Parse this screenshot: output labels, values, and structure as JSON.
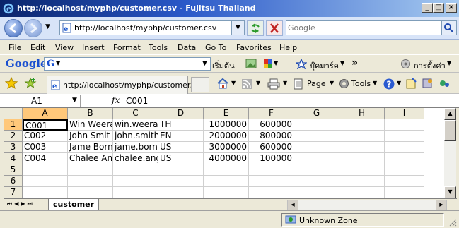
{
  "window": {
    "title": "http://localhost/myphp/customer.csv - Fujitsu Thailand"
  },
  "address": {
    "url": "http://localhost/myphp/customer.csv"
  },
  "search": {
    "placeholder": "Google"
  },
  "menu": [
    "File",
    "Edit",
    "View",
    "Insert",
    "Format",
    "Tools",
    "Data",
    "Go To",
    "Favorites",
    "Help"
  ],
  "google_bar": {
    "logo": "Google",
    "search_letter": "G",
    "search_btn": "เริ่มต้น",
    "bookmarks": "บุ๊คมาร์ค",
    "settings": "การตั้งค่า",
    "more": "»"
  },
  "tab": {
    "label": "http://localhost/myphp/customer...."
  },
  "toolbar": {
    "page": "Page",
    "tools": "Tools"
  },
  "formula": {
    "cellref": "A1",
    "fx": "fx",
    "value": "C001"
  },
  "sheet": {
    "columns": [
      "A",
      "B",
      "C",
      "D",
      "E",
      "F",
      "G",
      "H",
      "I"
    ],
    "rows": [
      {
        "n": "1",
        "cells": [
          "C001",
          "Win Weeras",
          "win.weerac",
          "TH",
          "1000000",
          "600000"
        ]
      },
      {
        "n": "2",
        "cells": [
          "C002",
          "John  Smit",
          "john.smithe",
          "EN",
          "2000000",
          "800000"
        ]
      },
      {
        "n": "3",
        "cells": [
          "C003",
          "Jame Born",
          "jame.born@",
          "US",
          "3000000",
          "600000"
        ]
      },
      {
        "n": "4",
        "cells": [
          "C004",
          "Chalee An",
          "chalee.ang",
          "US",
          "4000000",
          "100000"
        ]
      },
      {
        "n": "5",
        "cells": [
          "",
          "",
          "",
          "",
          "",
          ""
        ]
      },
      {
        "n": "6",
        "cells": [
          "",
          "",
          "",
          "",
          "",
          ""
        ]
      },
      {
        "n": "7",
        "cells": [
          "",
          "",
          "",
          "",
          "",
          ""
        ]
      }
    ],
    "tab_name": "customer"
  },
  "status": {
    "zone": "Unknown Zone"
  }
}
